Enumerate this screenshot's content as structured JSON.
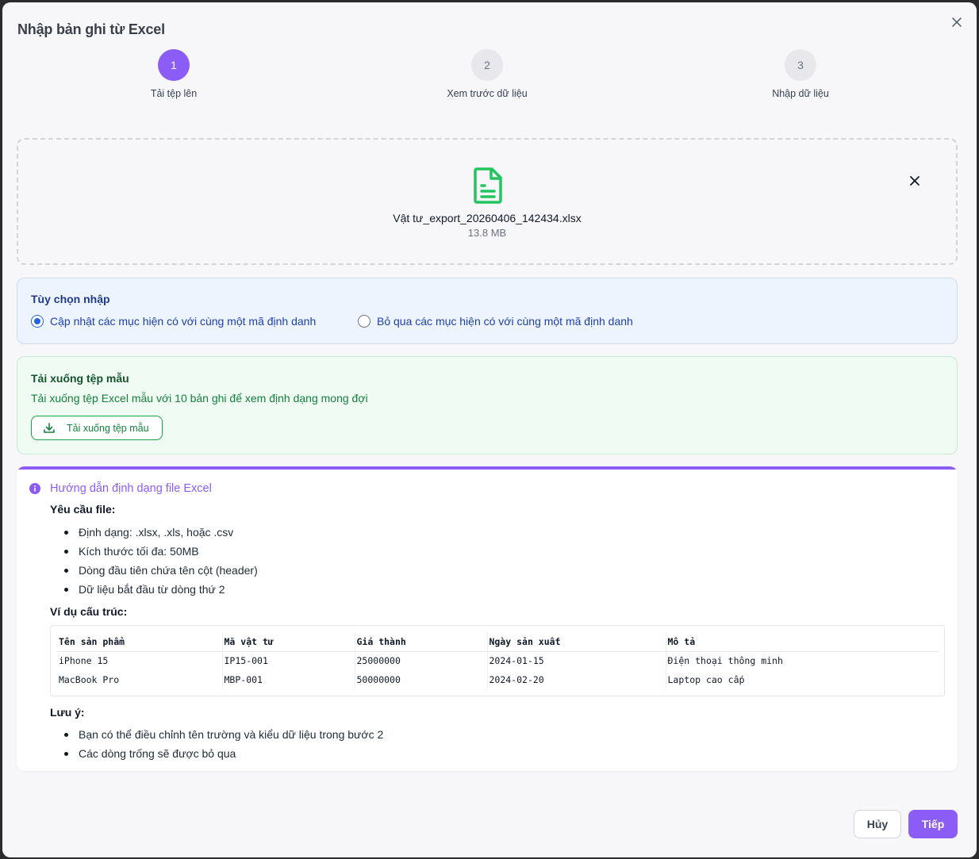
{
  "dialog": {
    "title": "Nhập bản ghi từ Excel"
  },
  "stepper": {
    "steps": [
      {
        "number": "1",
        "label": "Tải tệp lên"
      },
      {
        "number": "2",
        "label": "Xem trước dữ liệu"
      },
      {
        "number": "3",
        "label": "Nhập dữ liệu"
      }
    ],
    "active_color": "#8b5cf6"
  },
  "file": {
    "name": "Vật tư_export_20260406_142434.xlsx",
    "size": "13.8 MB",
    "icon": "file-text-icon",
    "icon_color": "#22c55e"
  },
  "import_options": {
    "heading": "Tùy chọn nhập",
    "options": [
      {
        "label": "Cập nhật các mục hiện có với cùng một mã định danh",
        "checked": true
      },
      {
        "label": "Bỏ qua các mục hiện có với cùng một mã định danh",
        "checked": false
      }
    ]
  },
  "template": {
    "heading": "Tải xuống tệp mẫu",
    "description": "Tải xuống tệp Excel mẫu với 10 bản ghi để xem định dạng mong đợi",
    "button_label": "Tải xuống tệp mẫu"
  },
  "guide": {
    "heading": "Hướng dẫn định dạng file Excel",
    "requirements_title": "Yêu cầu file:",
    "requirements": [
      "Định dạng: .xlsx, .xls, hoặc .csv",
      "Kích thước tối đa: 50MB",
      "Dòng đầu tiên chứa tên cột (header)",
      "Dữ liệu bắt đầu từ dòng thứ 2"
    ],
    "example_title": "Ví dụ cấu trúc:",
    "example_table": {
      "headers": [
        "Tên sản phẩm",
        "Mã vật tư",
        "Giá thành",
        "Ngày sản xuất",
        "Mô tả"
      ],
      "rows": [
        [
          "iPhone 15",
          "IP15-001",
          "25000000",
          "2024-01-15",
          "Điện thoại thông minh"
        ],
        [
          "MacBook Pro",
          "MBP-001",
          "50000000",
          "2024-02-20",
          "Laptop cao cấp"
        ]
      ]
    },
    "notes_title": "Lưu ý:",
    "notes": [
      "Bạn có thể điều chỉnh tên trường và kiểu dữ liệu trong bước 2",
      "Các dòng trống sẽ được bỏ qua"
    ]
  },
  "footer": {
    "cancel_label": "Hủy",
    "next_label": "Tiếp"
  }
}
